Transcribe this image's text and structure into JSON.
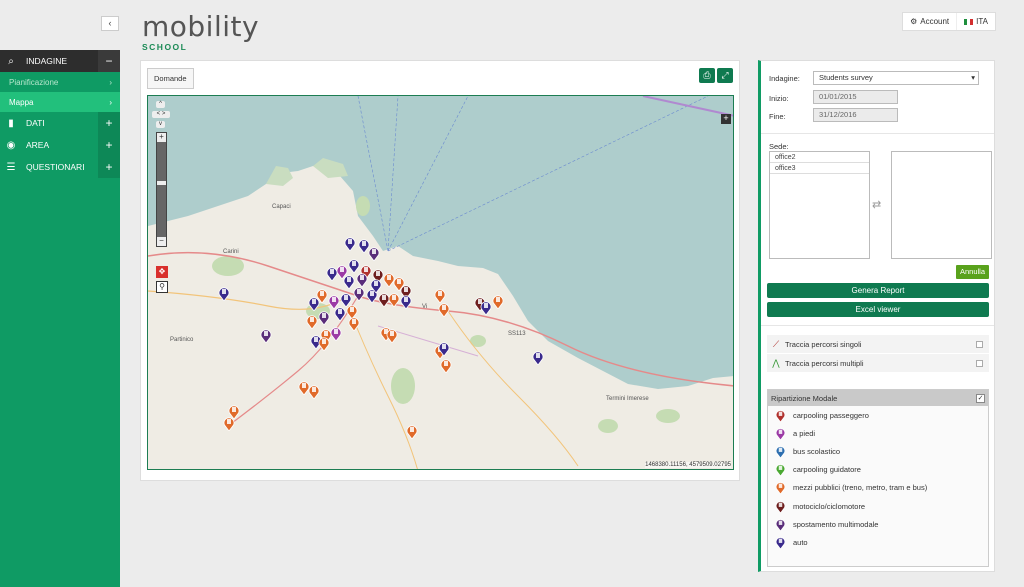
{
  "sidebar": {
    "collapse_icon": "chevron-left-icon",
    "indagine": {
      "label": "INDAGINE",
      "action": "−"
    },
    "pianificazione": "Pianificazione",
    "mappa": "Mappa",
    "items": [
      {
        "label": "DATI",
        "icon": "bar-chart-icon",
        "action": "+"
      },
      {
        "label": "AREA",
        "icon": "map-marker-icon",
        "action": "+"
      },
      {
        "label": "QUESTIONARI",
        "icon": "list-icon",
        "action": "+"
      }
    ]
  },
  "header": {
    "logo_main": "mobility",
    "logo_sub": "SCHOOL",
    "account_label": "Account",
    "language_label": "ITA"
  },
  "main": {
    "domande_label": "Domande",
    "map_coords": "1468380.11156, 4579509.02795",
    "place_labels": [
      "Capaci",
      "Carini",
      "Partinico",
      "Termini Imerese",
      "SS113",
      "Vi"
    ]
  },
  "filters": {
    "indagine_label": "Indagine:",
    "indagine_value": "Students survey",
    "inizio_label": "Inizio:",
    "inizio_value": "01/01/2015",
    "fine_label": "Fine:",
    "fine_value": "31/12/2016",
    "sede_label": "Sede:",
    "sede_options": [
      "office2",
      "office3"
    ],
    "annulla_label": "Annulla",
    "genera_label": "Genera Report",
    "excel_label": "Excel viewer",
    "traccia_singoli": "Traccia percorsi singoli",
    "traccia_multipli": "Traccia percorsi multipli",
    "ripartizione_label": "Ripartizione Modale",
    "legend": [
      {
        "label": "carpooling passeggero",
        "color": "#b0322e"
      },
      {
        "label": "a piedi",
        "color": "#9b3aa5"
      },
      {
        "label": "bus scolastico",
        "color": "#2e6fb0"
      },
      {
        "label": "carpooling guidatore",
        "color": "#4aa832"
      },
      {
        "label": "mezzi pubblici (treno, metro, tram e bus)",
        "color": "#e06a2a"
      },
      {
        "label": "motociclo/ciclomotore",
        "color": "#6e1f1f"
      },
      {
        "label": "spostamento multimodale",
        "color": "#5a2d7a"
      },
      {
        "label": "auto",
        "color": "#3a2a8c"
      }
    ]
  }
}
